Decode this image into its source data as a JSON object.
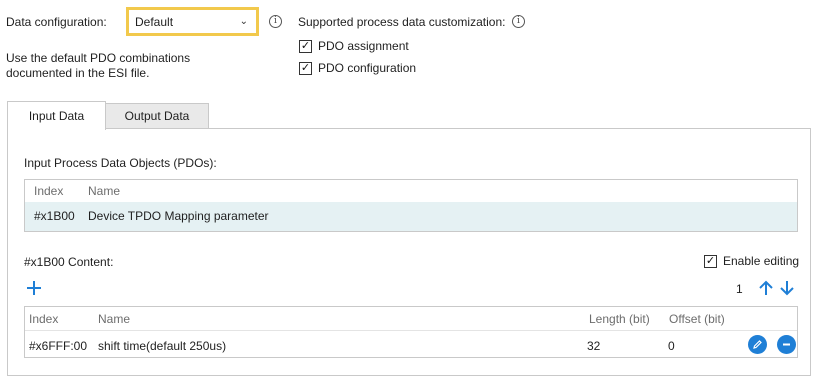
{
  "config": {
    "label": "Data configuration:",
    "selected": "Default",
    "description_line1": "Use the default PDO combinations",
    "description_line2": "documented in the ESI file."
  },
  "customization": {
    "label": "Supported process data customization:",
    "options": [
      {
        "label": "PDO assignment",
        "checked": true
      },
      {
        "label": "PDO configuration",
        "checked": true
      }
    ]
  },
  "tabs": [
    {
      "label": "Input Data",
      "active": true
    },
    {
      "label": "Output Data",
      "active": false
    }
  ],
  "pdo_section": {
    "title": "Input Process Data Objects (PDOs):",
    "headers": {
      "index": "Index",
      "name": "Name"
    },
    "rows": [
      {
        "index": "#x1B00",
        "name": "Device TPDO Mapping parameter"
      }
    ]
  },
  "content_section": {
    "title": "#x1B00 Content:",
    "enable_editing": "Enable editing",
    "count": "1",
    "headers": {
      "index": "Index",
      "name": "Name",
      "length": "Length (bit)",
      "offset": "Offset (bit)"
    },
    "rows": [
      {
        "index": "#x6FFF:00",
        "name": "shift time(default 250us)",
        "length": "32",
        "offset": "0"
      }
    ]
  },
  "icons": {
    "info": "info-icon",
    "add": "plus-icon",
    "move_up": "arrow-up-icon",
    "move_down": "arrow-down-icon",
    "edit": "pencil-icon",
    "remove": "minus-circle-icon"
  },
  "colors": {
    "accent": "#1f7fd6",
    "focus_border": "#f2c94c",
    "selected_row": "#e5f1f3"
  }
}
